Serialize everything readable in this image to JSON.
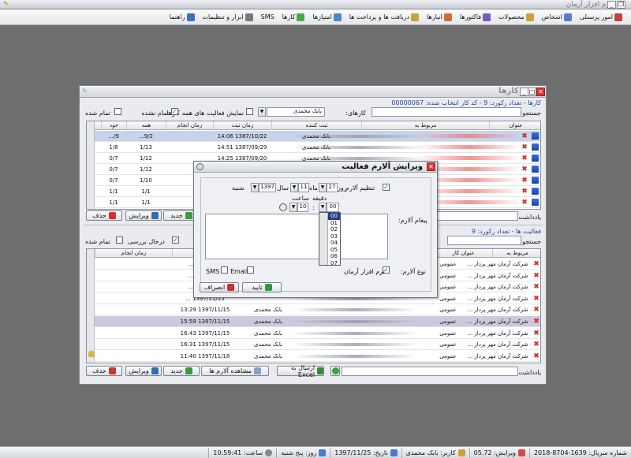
{
  "app": {
    "title": "نرم افزار آرمان"
  },
  "menu": [
    {
      "label": "امور پرسنلی",
      "color": "#c84040"
    },
    {
      "label": "اشخاص",
      "color": "#5a7ad0"
    },
    {
      "label": "محصولات",
      "color": "#c9a23a"
    },
    {
      "label": "فاکتورها",
      "color": "#7a58c0"
    },
    {
      "label": "انبارها",
      "color": "#d06a3a"
    },
    {
      "label": "دریافت ها و پرداخت ها",
      "color": "#c9a23a"
    },
    {
      "label": "امتیازها",
      "color": "#4a88c8"
    },
    {
      "label": "کارها",
      "color": "#4aa84a"
    },
    {
      "label": "SMS",
      "color": ""
    },
    {
      "label": "ابزار و تنظیمات",
      "color": "#7a7a7a"
    },
    {
      "label": "راهنما",
      "color": "#3a70c0"
    }
  ],
  "tasks_window": {
    "title": "کارها",
    "info": "کارها - تعداد رکورد: 9 - کد کار انتخاب شده: 00000067",
    "search_label": "جستجو:",
    "tasks_label": "کارهای:",
    "user_value": "بابک محمدی",
    "show_all_label": "نمایش فعالیت های همه کارها",
    "not_done_label": "تمام نشده",
    "done_label": "تمام شده",
    "columns": [
      "عنوان",
      "مربوط به",
      "ثبت کننده",
      "زمان ثبت",
      "زمان انجام",
      "همه",
      "خود"
    ],
    "rows": [
      {
        "creator": "بابک محمدی",
        "registered": "1387/10/22 14:06",
        "all": "9/2...",
        "own": "9/..."
      },
      {
        "creator": "بابک محمدی",
        "registered": "1387/09/29 14:51",
        "all": "1/13",
        "own": "1/8"
      },
      {
        "creator": "بابک محمدی",
        "registered": "1387/09/20 14:25",
        "all": "1/12",
        "own": "0/7"
      },
      {
        "creator": "",
        "registered": "",
        "all": "1/12",
        "own": "0/7"
      },
      {
        "creator": "",
        "registered": "",
        "all": "1/10",
        "own": "0/7"
      },
      {
        "creator": "",
        "registered": "",
        "all": "1/1",
        "own": "1/1"
      },
      {
        "creator": "",
        "registered": "",
        "all": "1/1",
        "own": "1/1"
      }
    ],
    "note_label": "یادداشت:",
    "new_label": "جدید",
    "edit_label": "ویرایش",
    "delete_label": "حذف",
    "activities_info": "فعالیت ها - تعداد رکورد: 9",
    "activities_search_label": "جستجو:",
    "in_review_label": "درحال بررسی",
    "act_done_label": "انجام شده",
    "act_not_done_label": "انجام نشده",
    "act_columns": [
      "مربوط به",
      "عنوان کار",
      "زمان انجام"
    ],
    "act_rows": [
      {
        "title": "عمومی",
        "company": "شرکت آرمان مهر پرداز ...",
        "creator": "",
        "time": "1393/05/2..."
      },
      {
        "title": "عمومی",
        "company": "شرکت آرمان مهر پرداز ...",
        "creator": "",
        "time": "1395/05/3..."
      },
      {
        "title": "عمومی",
        "company": "شرکت آرمان مهر پرداز ...",
        "creator": "",
        "time": "1397/02/1..."
      },
      {
        "title": "عمومی",
        "company": "شرکت آرمان مهر پرداز ...",
        "creator": "",
        "time": "1397/11/15 ..."
      },
      {
        "title": "عمومی",
        "company": "شرکت آرمان مهر پرداز ...",
        "creator": "بابک محمدی",
        "time": "1397/11/15 13:29"
      },
      {
        "title": "عمومی",
        "company": "شرکت آرمان مهر پرداز ...",
        "creator": "بابک محمدی",
        "time": "1397/11/15 15:59"
      },
      {
        "title": "عمومی",
        "company": "شرکت آرمان مهر پرداز ...",
        "creator": "بابک محمدی",
        "time": "1397/11/15 16:43"
      },
      {
        "title": "عمومی",
        "company": "شرکت آرمان مهر پرداز ...",
        "creator": "بابک محمدی",
        "time": "1397/11/15 16:31"
      },
      {
        "title": "عمومی",
        "company": "شرکت آرمان مهر پرداز ...",
        "creator": "بابک محمدی",
        "time": "1397/11/18 11:40"
      }
    ],
    "act_note_label": "یادداشت:",
    "view_alarms_label": "مشاهده آلارم ها",
    "export_excel_label": "ارسال به Excel"
  },
  "alarm_dialog": {
    "title": "ویرایش آلارم فعالیت",
    "set_alarm_label": "تنظیم آلارم",
    "day_label": "روز",
    "day_value": "27",
    "month_label": "ماه",
    "month_value": "11",
    "year_label": "سال",
    "year_value": "1397",
    "weekday_value": "شنبه",
    "minute_label": "دقیقه",
    "hour_label": "ساعت",
    "hour_value": "10",
    "minute_value": "00",
    "minute_options": [
      "00",
      "01",
      "02",
      "03",
      "04",
      "05",
      "06",
      "07"
    ],
    "message_label": "پیغام آلارم:",
    "type_label": "نوع آلارم:",
    "software_label": "نرم افزار آرمان",
    "email_label": "Email",
    "sms_label": "SMS",
    "confirm_label": "تایید",
    "cancel_label": "انصراف"
  },
  "status": {
    "serial": "شماره سریال: 1639-8704-2018",
    "version": "ویرایش: 05.72",
    "user": "کاربر: بابک محمدی",
    "date": "تاریخ: 1397/11/25",
    "weekday": "روز: پنج شنبه",
    "time": "ساعت: 10:59:41"
  }
}
